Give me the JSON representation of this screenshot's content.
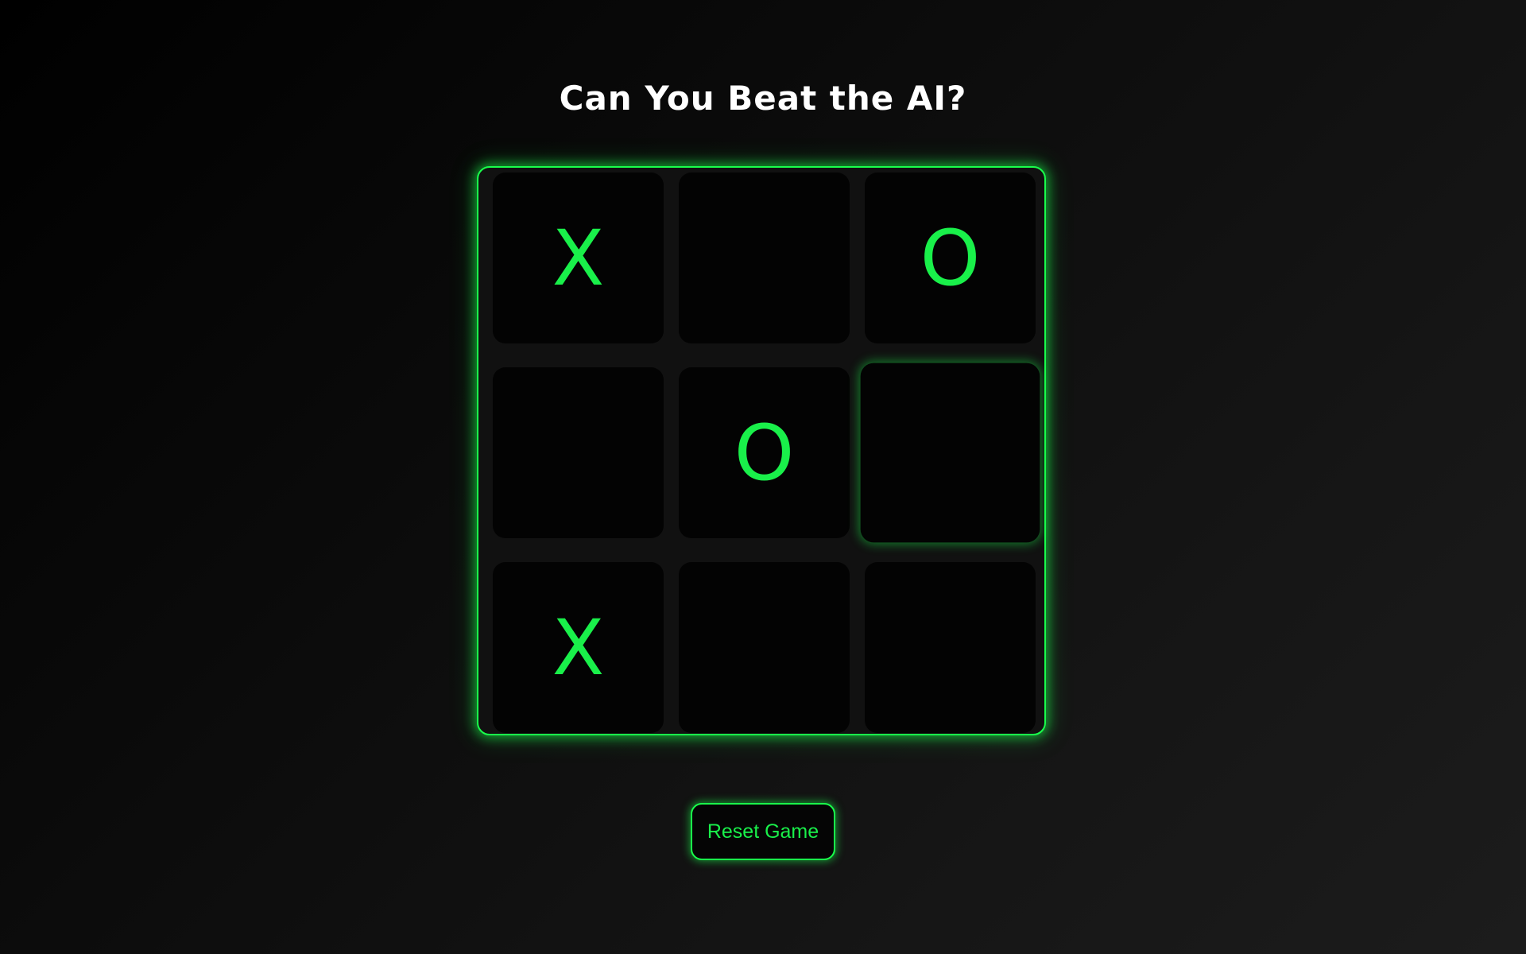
{
  "title": "Can You Beat the AI?",
  "board": {
    "cells": [
      "X",
      "",
      "O",
      "",
      "O",
      "",
      "X",
      "",
      ""
    ],
    "hovered_cell": 5
  },
  "reset_button": {
    "label": "Reset Game"
  },
  "colors": {
    "accent": "#19ff4b",
    "mark": "#19f04a",
    "cell_background": "#030303",
    "title": "#ffffff"
  }
}
